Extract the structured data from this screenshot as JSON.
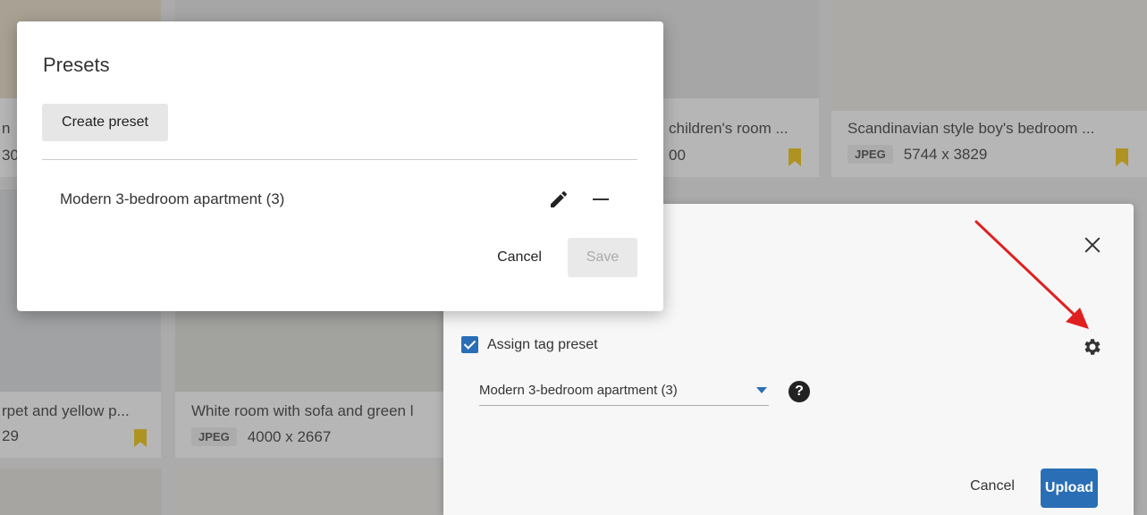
{
  "gallery": {
    "tiles": [
      {
        "caption": "n",
        "dimensions": "30"
      },
      {
        "caption": "children's room ...",
        "dimensions": "00"
      },
      {
        "caption": "Scandinavian style boy's bedroom ...",
        "format": "JPEG",
        "dimensions": "5744 x 3829"
      },
      {
        "caption": "rpet and yellow p...",
        "dimensions": "29"
      },
      {
        "caption": "White room with sofa and green l",
        "format": "JPEG",
        "dimensions": "4000 x 2667"
      }
    ],
    "bookmark_color": "#f3c300"
  },
  "upload_panel": {
    "assign_tag_preset_label": "Assign tag preset",
    "selected_preset": "Modern 3-bedroom apartment (3)",
    "help_symbol": "?",
    "cancel_label": "Cancel",
    "upload_label": "Upload",
    "accent_color": "#2a6fb6"
  },
  "presets_modal": {
    "title": "Presets",
    "create_label": "Create preset",
    "presets": [
      {
        "name": "Modern 3-bedroom apartment (3)"
      }
    ],
    "cancel_label": "Cancel",
    "save_label": "Save"
  },
  "icons": [
    "close-icon",
    "gear-icon",
    "help-icon",
    "pencil-icon",
    "minus-icon",
    "bookmark-icon",
    "chevron-down-icon"
  ],
  "annotation_color": "#e02020"
}
